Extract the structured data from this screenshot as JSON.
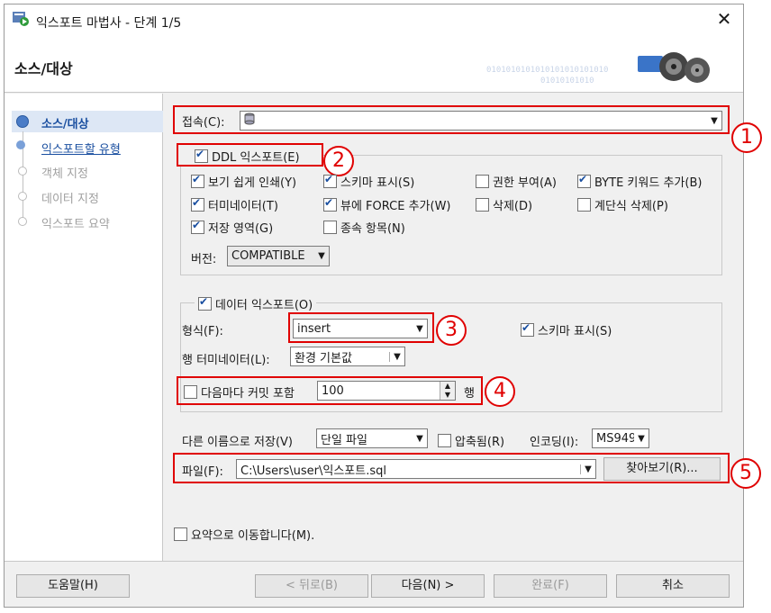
{
  "window": {
    "title": "익스포트 마법사 - 단계 1/5",
    "close_label": "✕",
    "header": "소스/대상"
  },
  "steps": [
    {
      "label": "소스/대상",
      "state": "active"
    },
    {
      "label": "익스포트할 유형",
      "state": "link"
    },
    {
      "label": "객체 지정",
      "state": "disabled"
    },
    {
      "label": "데이터 지정",
      "state": "disabled"
    },
    {
      "label": "익스포트 요약",
      "state": "disabled"
    }
  ],
  "connection": {
    "label": "접속(C):",
    "value": ""
  },
  "ddl": {
    "label": "DDL 익스포트(E)",
    "checked": true,
    "options": [
      {
        "label": "보기 쉽게 인쇄(Y)",
        "checked": true
      },
      {
        "label": "스키마 표시(S)",
        "checked": true
      },
      {
        "label": "권한 부여(A)",
        "checked": false
      },
      {
        "label": "BYTE 키워드 추가(B)",
        "checked": true
      },
      {
        "label": "터미네이터(T)",
        "checked": true
      },
      {
        "label": "뷰에 FORCE 추가(W)",
        "checked": true
      },
      {
        "label": "삭제(D)",
        "checked": false
      },
      {
        "label": "계단식 삭제(P)",
        "checked": false
      },
      {
        "label": "저장 영역(G)",
        "checked": true
      },
      {
        "label": "종속 항목(N)",
        "checked": false
      }
    ],
    "version_label": "버전:",
    "version_value": "COMPATIBLE"
  },
  "data_export": {
    "label": "데이터 익스포트(O)",
    "checked": true,
    "format_label": "형식(F):",
    "format_value": "insert",
    "schema_label": "스키마 표시(S)",
    "schema_checked": true,
    "row_term_label": "행 터미네이터(L):",
    "row_term_value": "환경 기본값",
    "commit_label": "다음마다 커밋 포함",
    "commit_checked": false,
    "commit_value": "100",
    "commit_unit": "행"
  },
  "save": {
    "save_as_label": "다른 이름으로 저장(V)",
    "save_as_value": "단일 파일",
    "compressed_label": "압축됨(R)",
    "compressed_checked": false,
    "encoding_label": "인코딩(I):",
    "encoding_value": "MS949",
    "file_label": "파일(F):",
    "file_value": "C:\\Users\\user\\익스포트.sql",
    "browse_label": "찾아보기(R)..."
  },
  "summary": {
    "label": "요약으로 이동합니다(M).",
    "checked": false
  },
  "footer": {
    "help": "도움말(H)",
    "back": "< 뒤로(B)",
    "next": "다음(N) >",
    "finish": "완료(F)",
    "cancel": "취소"
  },
  "annotations": [
    "1",
    "2",
    "3",
    "4",
    "5"
  ],
  "colors": {
    "annotation_red": "#e00000",
    "active_step": "#1a4fa0",
    "link_step": "#1a4fa0"
  }
}
